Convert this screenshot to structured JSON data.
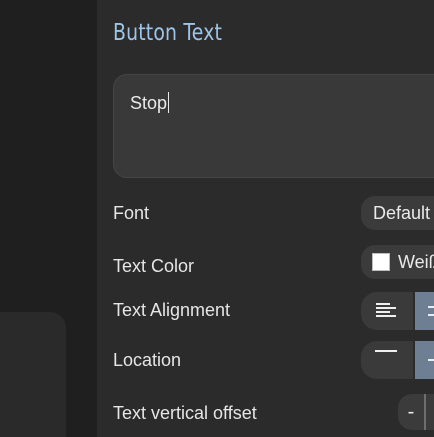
{
  "section": {
    "title": "Button Text"
  },
  "button_text": {
    "value": "Stop"
  },
  "rows": {
    "font": {
      "label": "Font",
      "value": "Default"
    },
    "text_color": {
      "label": "Text Color",
      "value": "Weiß",
      "swatch_color": "#ffffff"
    },
    "text_alignment": {
      "label": "Text Alignment",
      "selected": "center"
    },
    "location": {
      "label": "Location",
      "selected": "middle"
    },
    "text_vertical_offset": {
      "label": "Text vertical offset",
      "decrement_label": "-"
    }
  },
  "colors": {
    "title": "#9ec5e8",
    "panel_bg": "#2b2b2b",
    "control_bg": "#3b3b3b",
    "selected_segment": "#6f7f93"
  },
  "icons": {
    "align_left": "align-left-icon",
    "align_center": "align-center-icon",
    "location_top": "align-top-icon",
    "location_middle": "align-middle-icon"
  }
}
